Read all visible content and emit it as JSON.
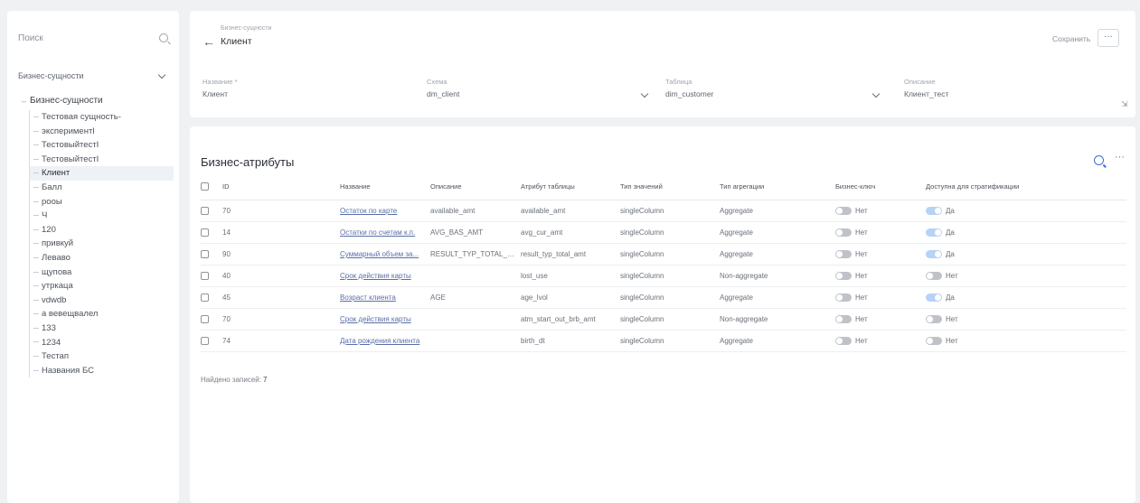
{
  "sidebar": {
    "search_placeholder": "Поиск",
    "select_value": "Бизнес-сущности",
    "root_label": "Бизнес-сущности",
    "items": [
      {
        "label": "Тестовая сущность-",
        "active": false
      },
      {
        "label": "экспериментI",
        "active": false
      },
      {
        "label": "ТестовыйтестI",
        "active": false
      },
      {
        "label": "ТестовыйтестI",
        "active": false
      },
      {
        "label": "Клиент",
        "active": true
      },
      {
        "label": "Балл",
        "active": false
      },
      {
        "label": "рооы",
        "active": false
      },
      {
        "label": "Ч",
        "active": false
      },
      {
        "label": "120",
        "active": false
      },
      {
        "label": "привкуй",
        "active": false
      },
      {
        "label": "Леваво",
        "active": false
      },
      {
        "label": "щупова",
        "active": false
      },
      {
        "label": "утркаца",
        "active": false
      },
      {
        "label": "vdwdb",
        "active": false
      },
      {
        "label": "а вевещвалел",
        "active": false
      },
      {
        "label": "133",
        "active": false
      },
      {
        "label": "1234",
        "active": false
      },
      {
        "label": "Тестап",
        "active": false
      },
      {
        "label": "Названия БС",
        "active": false
      }
    ]
  },
  "header": {
    "breadcrumb": "Бизнес-сущности",
    "title": "Клиент",
    "action_label": "Сохранить",
    "more_label": "···",
    "fields": [
      {
        "label": "Название *",
        "value": "Клиент"
      },
      {
        "label": "Схема",
        "value": "dm_client"
      },
      {
        "label": "Таблица",
        "value": "dim_customer"
      },
      {
        "label": "Описание",
        "value": "Клиент_тест"
      }
    ]
  },
  "attributes": {
    "title": "Бизнес-атрибуты",
    "more_label": "···",
    "columns": [
      "ID",
      "Название",
      "Описание",
      "Атрибут таблицы",
      "Тип значений",
      "Тип агрегации",
      "Бизнес-ключ",
      "Доступна для стратификации"
    ],
    "rows": [
      {
        "id": "70",
        "name": "Остаток по карте",
        "code": "available_amt",
        "attr": "available_amt",
        "vtype": "singleColumn",
        "agg": "Aggregate",
        "key": "Нет",
        "avail": "Да",
        "avail_on": true
      },
      {
        "id": "14",
        "name": "Остатки по счетам к.п.",
        "code": "AVG_BAS_AMT",
        "attr": "avg_cur_amt",
        "vtype": "singleColumn",
        "agg": "Aggregate",
        "key": "Нет",
        "avail": "Да",
        "avail_on": true
      },
      {
        "id": "90",
        "name": "Суммарный объем за...",
        "code": "RESULT_TYP_TOTAL_A...",
        "attr": "result_typ_total_amt",
        "vtype": "singleColumn",
        "agg": "Aggregate",
        "key": "Нет",
        "avail": "Да",
        "avail_on": true
      },
      {
        "id": "40",
        "name": "Срок действия карты",
        "code": "",
        "attr": "lost_use",
        "vtype": "singleColumn",
        "agg": "Non-aggregate",
        "key": "Нет",
        "avail": "Нет",
        "avail_on": false
      },
      {
        "id": "45",
        "name": "Возраст клиента",
        "code": "AGE",
        "attr": "age_lvol",
        "vtype": "singleColumn",
        "agg": "Aggregate",
        "key": "Нет",
        "avail": "Да",
        "avail_on": true
      },
      {
        "id": "70",
        "name": "Срок действия карты",
        "code": "",
        "attr": "atm_start_out_brb_amt",
        "vtype": "singleColumn",
        "agg": "Non-aggregate",
        "key": "Нет",
        "avail": "Нет",
        "avail_on": false
      },
      {
        "id": "74",
        "name": "Дата рождения клиента",
        "code": "",
        "attr": "birth_dt",
        "vtype": "singleColumn",
        "agg": "Aggregate",
        "key": "Нет",
        "avail": "Нет",
        "avail_on": false
      }
    ],
    "footer_label": "Найдено записей:",
    "footer_count": "7"
  }
}
